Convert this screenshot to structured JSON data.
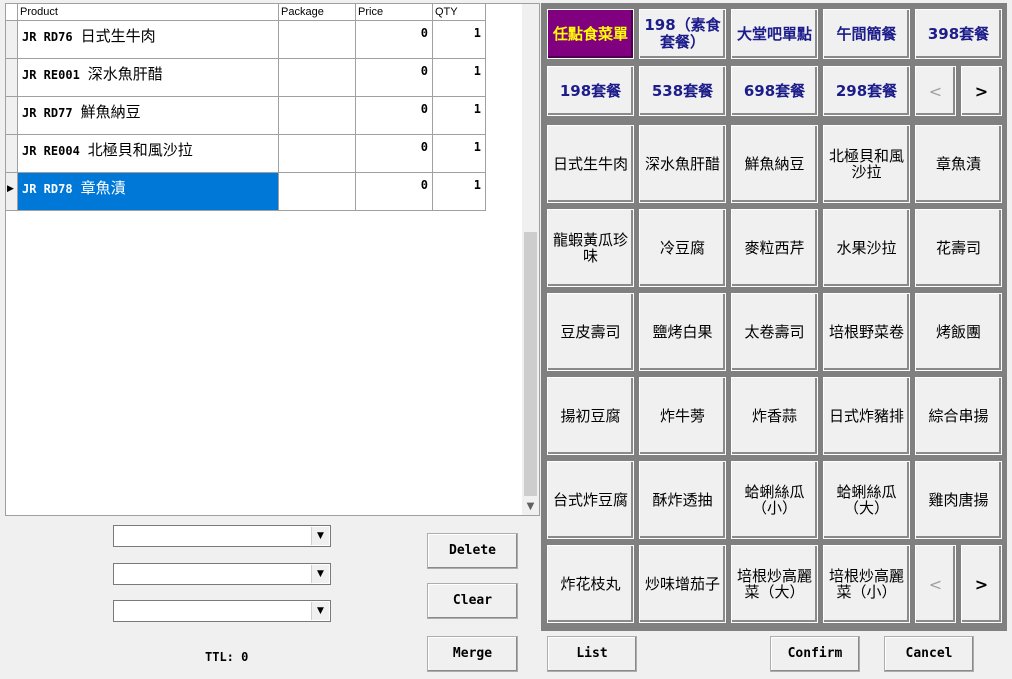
{
  "grid": {
    "columns": [
      "Product",
      "Package",
      "Price",
      "QTY"
    ],
    "rows": [
      {
        "code": "JR RD76",
        "name": "日式生牛肉",
        "package": "",
        "price": "0",
        "qty": "1"
      },
      {
        "code": "JR RE001",
        "name": "深水魚肝醋",
        "package": "",
        "price": "0",
        "qty": "1"
      },
      {
        "code": "JR RD77",
        "name": "鮮魚納豆",
        "package": "",
        "price": "0",
        "qty": "1"
      },
      {
        "code": "JR RE004",
        "name": "北極貝和風沙拉",
        "package": "",
        "price": "0",
        "qty": "1"
      },
      {
        "code": "JR RD78",
        "name": "章魚漬",
        "package": "",
        "price": "0",
        "qty": "1"
      }
    ],
    "selected_row": 4,
    "row_indicator": "▶"
  },
  "combos": [
    "",
    "",
    ""
  ],
  "buttons": {
    "delete": "Delete",
    "clear": "Clear",
    "merge": "Merge",
    "list": "List",
    "confirm": "Confirm",
    "cancel": "Cancel"
  },
  "ttl": "TTL: 0",
  "categories_row1": [
    "任點食菜單",
    "198（素食套餐）",
    "大堂吧單點",
    "午間簡餐",
    "398套餐"
  ],
  "categories_row2": [
    "198套餐",
    "538套餐",
    "698套餐",
    "298套餐"
  ],
  "nav": {
    "prev": "<",
    "next": ">"
  },
  "items": [
    [
      "日式生牛肉",
      "深水魚肝醋",
      "鮮魚納豆",
      "北極貝和風沙拉",
      "章魚漬"
    ],
    [
      "龍蝦黃瓜珍味",
      "冷豆腐",
      "麥粒西芹",
      "水果沙拉",
      "花壽司"
    ],
    [
      "豆皮壽司",
      "鹽烤白果",
      "太卷壽司",
      "培根野菜卷",
      "烤飯團"
    ],
    [
      "揚初豆腐",
      "炸牛蒡",
      "炸香蒜",
      "日式炸豬排",
      "綜合串揚"
    ],
    [
      "台式炸豆腐",
      "酥炸透抽",
      "蛤蜊絲瓜（小）",
      "蛤蜊絲瓜（大）",
      "雞肉唐揚"
    ],
    [
      "炸花枝丸",
      "炒味增茄子",
      "培根炒高麗菜（大）",
      "培根炒高麗菜（小）"
    ]
  ],
  "colors": {
    "active_category_bg": "#800080",
    "active_category_fg": "#ffff00",
    "selection": "#0078d7",
    "category_fg": "#1c1c8a"
  }
}
